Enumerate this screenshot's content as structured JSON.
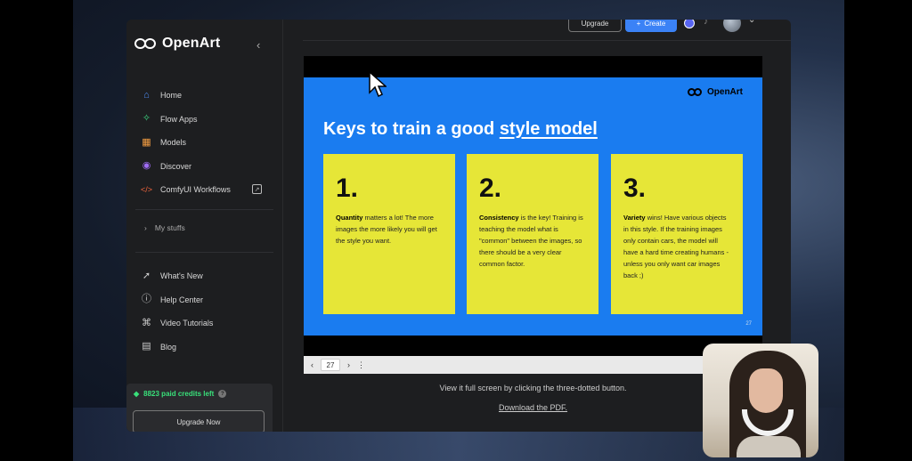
{
  "sidebar": {
    "brand": "OpenArt",
    "collapse_icon": "chevron-left-icon",
    "nav": [
      {
        "label": "Home",
        "icon": "home-icon",
        "color": "#4f8ff7"
      },
      {
        "label": "Flow Apps",
        "icon": "sparkle-icon",
        "color": "#3ddc84"
      },
      {
        "label": "Models",
        "icon": "grid-icon",
        "color": "#f59e42"
      },
      {
        "label": "Discover",
        "icon": "compass-icon",
        "color": "#a06cf5"
      },
      {
        "label": "ComfyUI Workflows",
        "icon": "code-icon",
        "color": "#f0643c"
      }
    ],
    "my_stuffs": "My stuffs",
    "nav2": [
      {
        "label": "What's New",
        "icon": "rocket-icon"
      },
      {
        "label": "Help Center",
        "icon": "help-icon"
      },
      {
        "label": "Video Tutorials",
        "icon": "graduation-cap-icon"
      },
      {
        "label": "Blog",
        "icon": "blog-icon"
      }
    ],
    "credits": "8823 paid credits left",
    "upgrade_now": "Upgrade Now"
  },
  "topbar": {
    "upgrade": "Upgrade",
    "create": "Create",
    "create_plus": "+"
  },
  "slide": {
    "brand": "OpenArt",
    "title_prefix": "Keys to train a good ",
    "title_link": "style model",
    "cards": [
      {
        "num": "1.",
        "bold": "Quantity",
        "text": " matters a lot! The more images the more likely you will get the style you want."
      },
      {
        "num": "2.",
        "bold": "Consistency",
        "text": " is the key! Training is teaching the model what is \"common\" between the images, so there should be a very clear common factor."
      },
      {
        "num": "3.",
        "bold": "Variety",
        "text": " wins! Have various objects in this style. If the training images only contain cars, the model will have a hard time creating humans - unless you only want car images back ;)"
      }
    ],
    "page_number": "27"
  },
  "viewer": {
    "prev": "‹",
    "page": "27",
    "next": "›",
    "menu": "⋮"
  },
  "hint": "View it full screen by clicking the three-dotted button.",
  "download": "Download the PDF."
}
